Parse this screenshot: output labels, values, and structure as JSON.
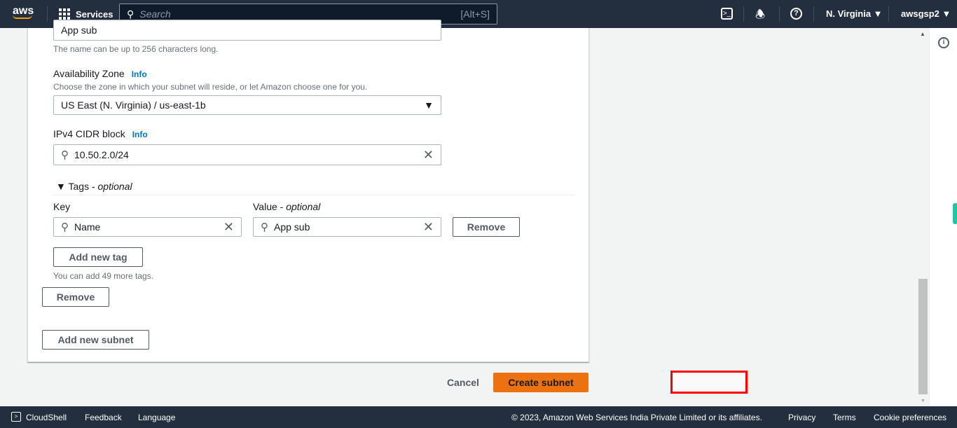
{
  "header": {
    "logo": "aws",
    "services": "Services",
    "search_placeholder": "Search",
    "search_shortcut": "[Alt+S]",
    "region": "N. Virginia",
    "account": "awsgsp2"
  },
  "form": {
    "name_value": "App sub",
    "name_hint": "The name can be up to 256 characters long.",
    "az_label": "Availability Zone",
    "info": "Info",
    "az_desc": "Choose the zone in which your subnet will reside, or let Amazon choose one for you.",
    "az_value": "US East (N. Virginia) / us-east-1b",
    "cidr_label": "IPv4 CIDR block",
    "cidr_value": "10.50.2.0/24",
    "tags_label": "Tags - ",
    "tags_optional": "optional",
    "key_label": "Key",
    "value_label": "Value - ",
    "value_optional": "optional",
    "tag_key": "Name",
    "tag_value": "App sub",
    "remove_tag": "Remove",
    "add_tag": "Add new tag",
    "tags_hint": "You can add 49 more tags.",
    "remove_subnet": "Remove",
    "add_subnet": "Add new subnet"
  },
  "actions": {
    "cancel": "Cancel",
    "create": "Create subnet"
  },
  "footer": {
    "cloudshell": "CloudShell",
    "feedback": "Feedback",
    "language": "Language",
    "copyright": "© 2023, Amazon Web Services India Private Limited or its affiliates.",
    "privacy": "Privacy",
    "terms": "Terms",
    "cookies": "Cookie preferences"
  },
  "colors": {
    "header": "#232f3e",
    "primary": "#ec7211",
    "link": "#0073bb",
    "highlight": "#ff0000"
  }
}
